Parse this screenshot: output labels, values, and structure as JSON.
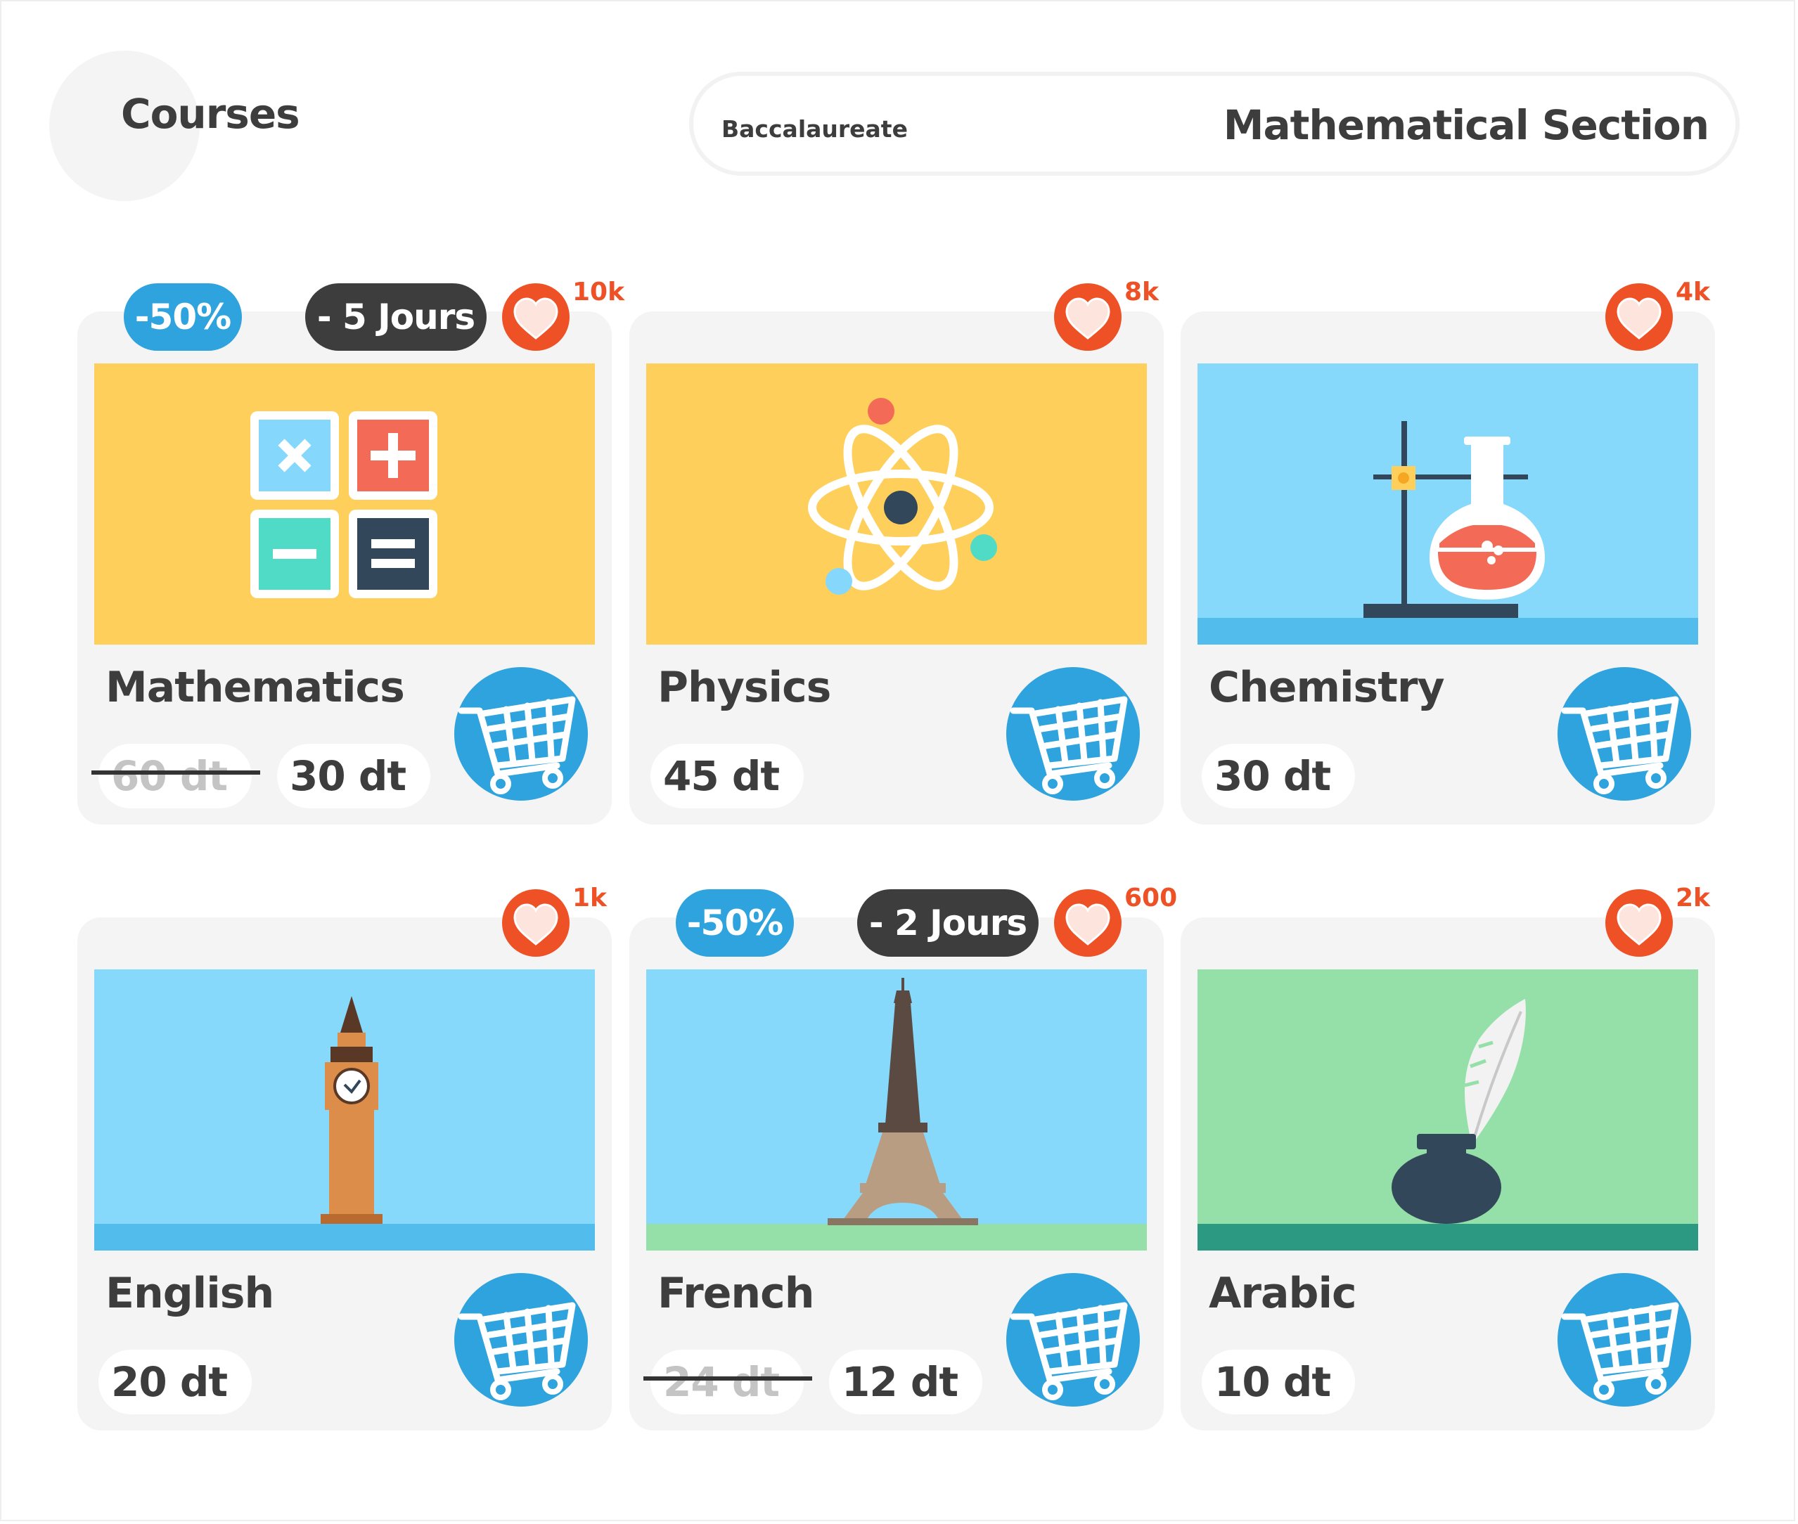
{
  "header": {
    "title": "Courses"
  },
  "section": {
    "level": "Baccalaureate",
    "name": "Mathematical Section"
  },
  "colors": {
    "accent": "#2ea3dd",
    "like": "#ee5125",
    "text": "#3d3d3d",
    "card": "#f4f4f4"
  },
  "courses": [
    {
      "name": "Mathematics",
      "price": "30 dt",
      "old_price": "60 dt",
      "discount": "-50%",
      "days_left": "- 5 Jours",
      "likes": "10k",
      "image_icon": "calculator-icon",
      "cart_icon": "cart-icon"
    },
    {
      "name": "Physics",
      "price": "45 dt",
      "likes": "8k",
      "image_icon": "atom-icon",
      "cart_icon": "cart-icon"
    },
    {
      "name": "Chemistry",
      "price": "30 dt",
      "likes": "4k",
      "image_icon": "flask-icon",
      "cart_icon": "cart-icon"
    },
    {
      "name": "English",
      "price": "20 dt",
      "likes": "1k",
      "image_icon": "big-ben-icon",
      "cart_icon": "cart-icon"
    },
    {
      "name": "French",
      "price": "12 dt",
      "old_price": "24 dt",
      "discount": "-50%",
      "days_left": "- 2 Jours",
      "likes": "600",
      "image_icon": "eiffel-tower-icon",
      "cart_icon": "cart-icon"
    },
    {
      "name": "Arabic",
      "price": "10 dt",
      "likes": "2k",
      "image_icon": "quill-ink-icon",
      "cart_icon": "cart-icon"
    }
  ]
}
